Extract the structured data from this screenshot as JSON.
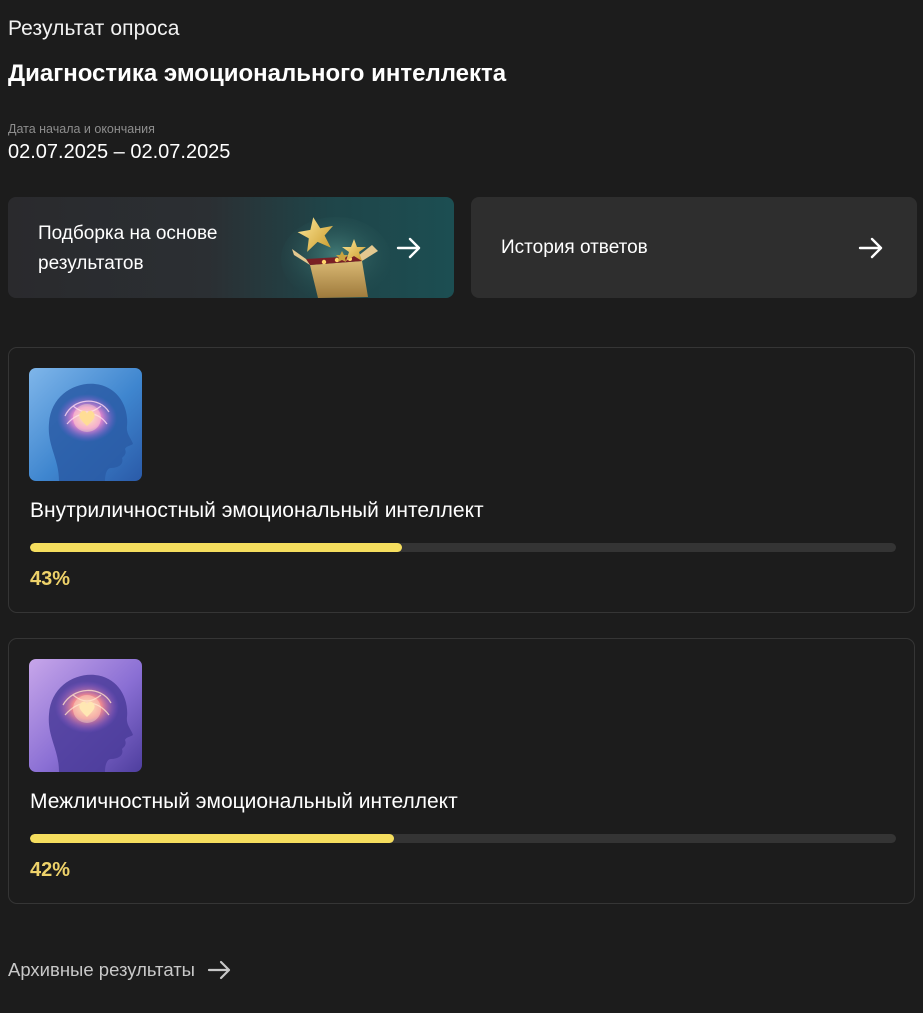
{
  "header": {
    "survey_label": "Результат опроса",
    "title": "Диагностика эмоционального интеллекта",
    "date_caption": "Дата начала и окончания",
    "date_range": "02.07.2025 – 02.07.2025"
  },
  "actions": {
    "selection_label": "Подборка на основе результатов",
    "selection_icon": "arrow-right-icon",
    "selection_art": "gift-box-stars-icon",
    "history_label": "История ответов",
    "history_icon": "arrow-right-icon"
  },
  "results": [
    {
      "title": "Внутриличностный эмоциональный интеллект",
      "percent_label": "43%",
      "progress": 43,
      "image": "head-brain-heart-blue-icon"
    },
    {
      "title": "Межличностный эмоциональный интеллект",
      "percent_label": "42%",
      "progress": 42,
      "image": "head-brain-heart-purple-icon"
    }
  ],
  "footer": {
    "archive_label": "Архивные результаты",
    "archive_icon": "arrow-right-icon"
  },
  "colors": {
    "background": "#1c1c1c",
    "progress_fill": "#f5de5e",
    "progress_track": "#343434",
    "percent_text": "#eed26a",
    "card_border": "#353535"
  }
}
